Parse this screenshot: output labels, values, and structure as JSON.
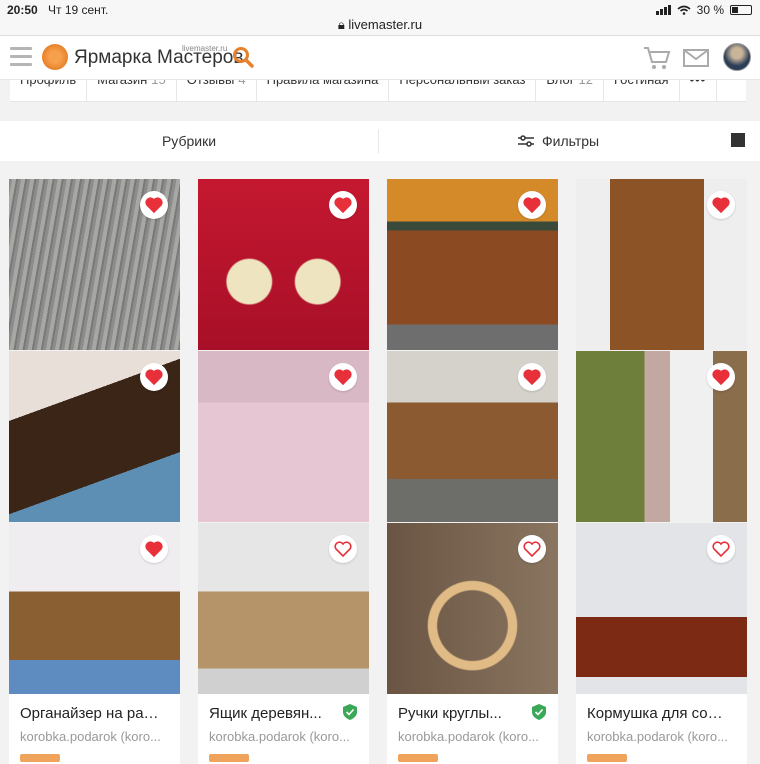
{
  "status": {
    "time": "20:50",
    "date": "Чт 19 сент.",
    "url": "livemaster.ru",
    "battery": "30 %"
  },
  "header": {
    "brand": "Ярмарка Мастеров",
    "brand_sub": "livemaster.ru",
    "accent": "#e8812b"
  },
  "tabs": [
    {
      "label": "Профиль",
      "count": ""
    },
    {
      "label": "Магазин",
      "count": "15"
    },
    {
      "label": "Отзывы",
      "count": "4"
    },
    {
      "label": "Правила магазина",
      "count": ""
    },
    {
      "label": "Персональный заказ",
      "count": ""
    },
    {
      "label": "Блог",
      "count": "12"
    },
    {
      "label": "Гостиная",
      "count": ""
    }
  ],
  "filterbar": {
    "rubriki": "Рубрики",
    "filters": "Фильтры"
  },
  "products": [
    {
      "name": "product-round-board",
      "liked": true
    },
    {
      "name": "product-spindles",
      "liked": true
    },
    {
      "name": "product-open-boxes",
      "liked": true
    },
    {
      "name": "product-cutting-board",
      "liked": true
    },
    {
      "name": "product-dark-board",
      "liked": true
    },
    {
      "name": "product-pink-box",
      "liked": true
    },
    {
      "name": "product-wood-chest",
      "liked": true
    },
    {
      "name": "product-white-stand",
      "liked": true
    },
    {
      "name": "product-organizer",
      "liked": true
    },
    {
      "name": "product-crate",
      "liked": false
    },
    {
      "name": "product-rings",
      "liked": false
    },
    {
      "name": "product-feeder",
      "liked": false
    }
  ],
  "cards": [
    {
      "title": "Органайзер на раб...",
      "shop": "korobka.podarok (koro...",
      "verified": false
    },
    {
      "title": "Ящик деревян...",
      "shop": "korobka.podarok (koro...",
      "verified": true
    },
    {
      "title": "Ручки круглы...",
      "shop": "korobka.podarok (koro...",
      "verified": true
    },
    {
      "title": "Кормушка для собак",
      "shop": "korobka.podarok (koro...",
      "verified": false
    }
  ]
}
